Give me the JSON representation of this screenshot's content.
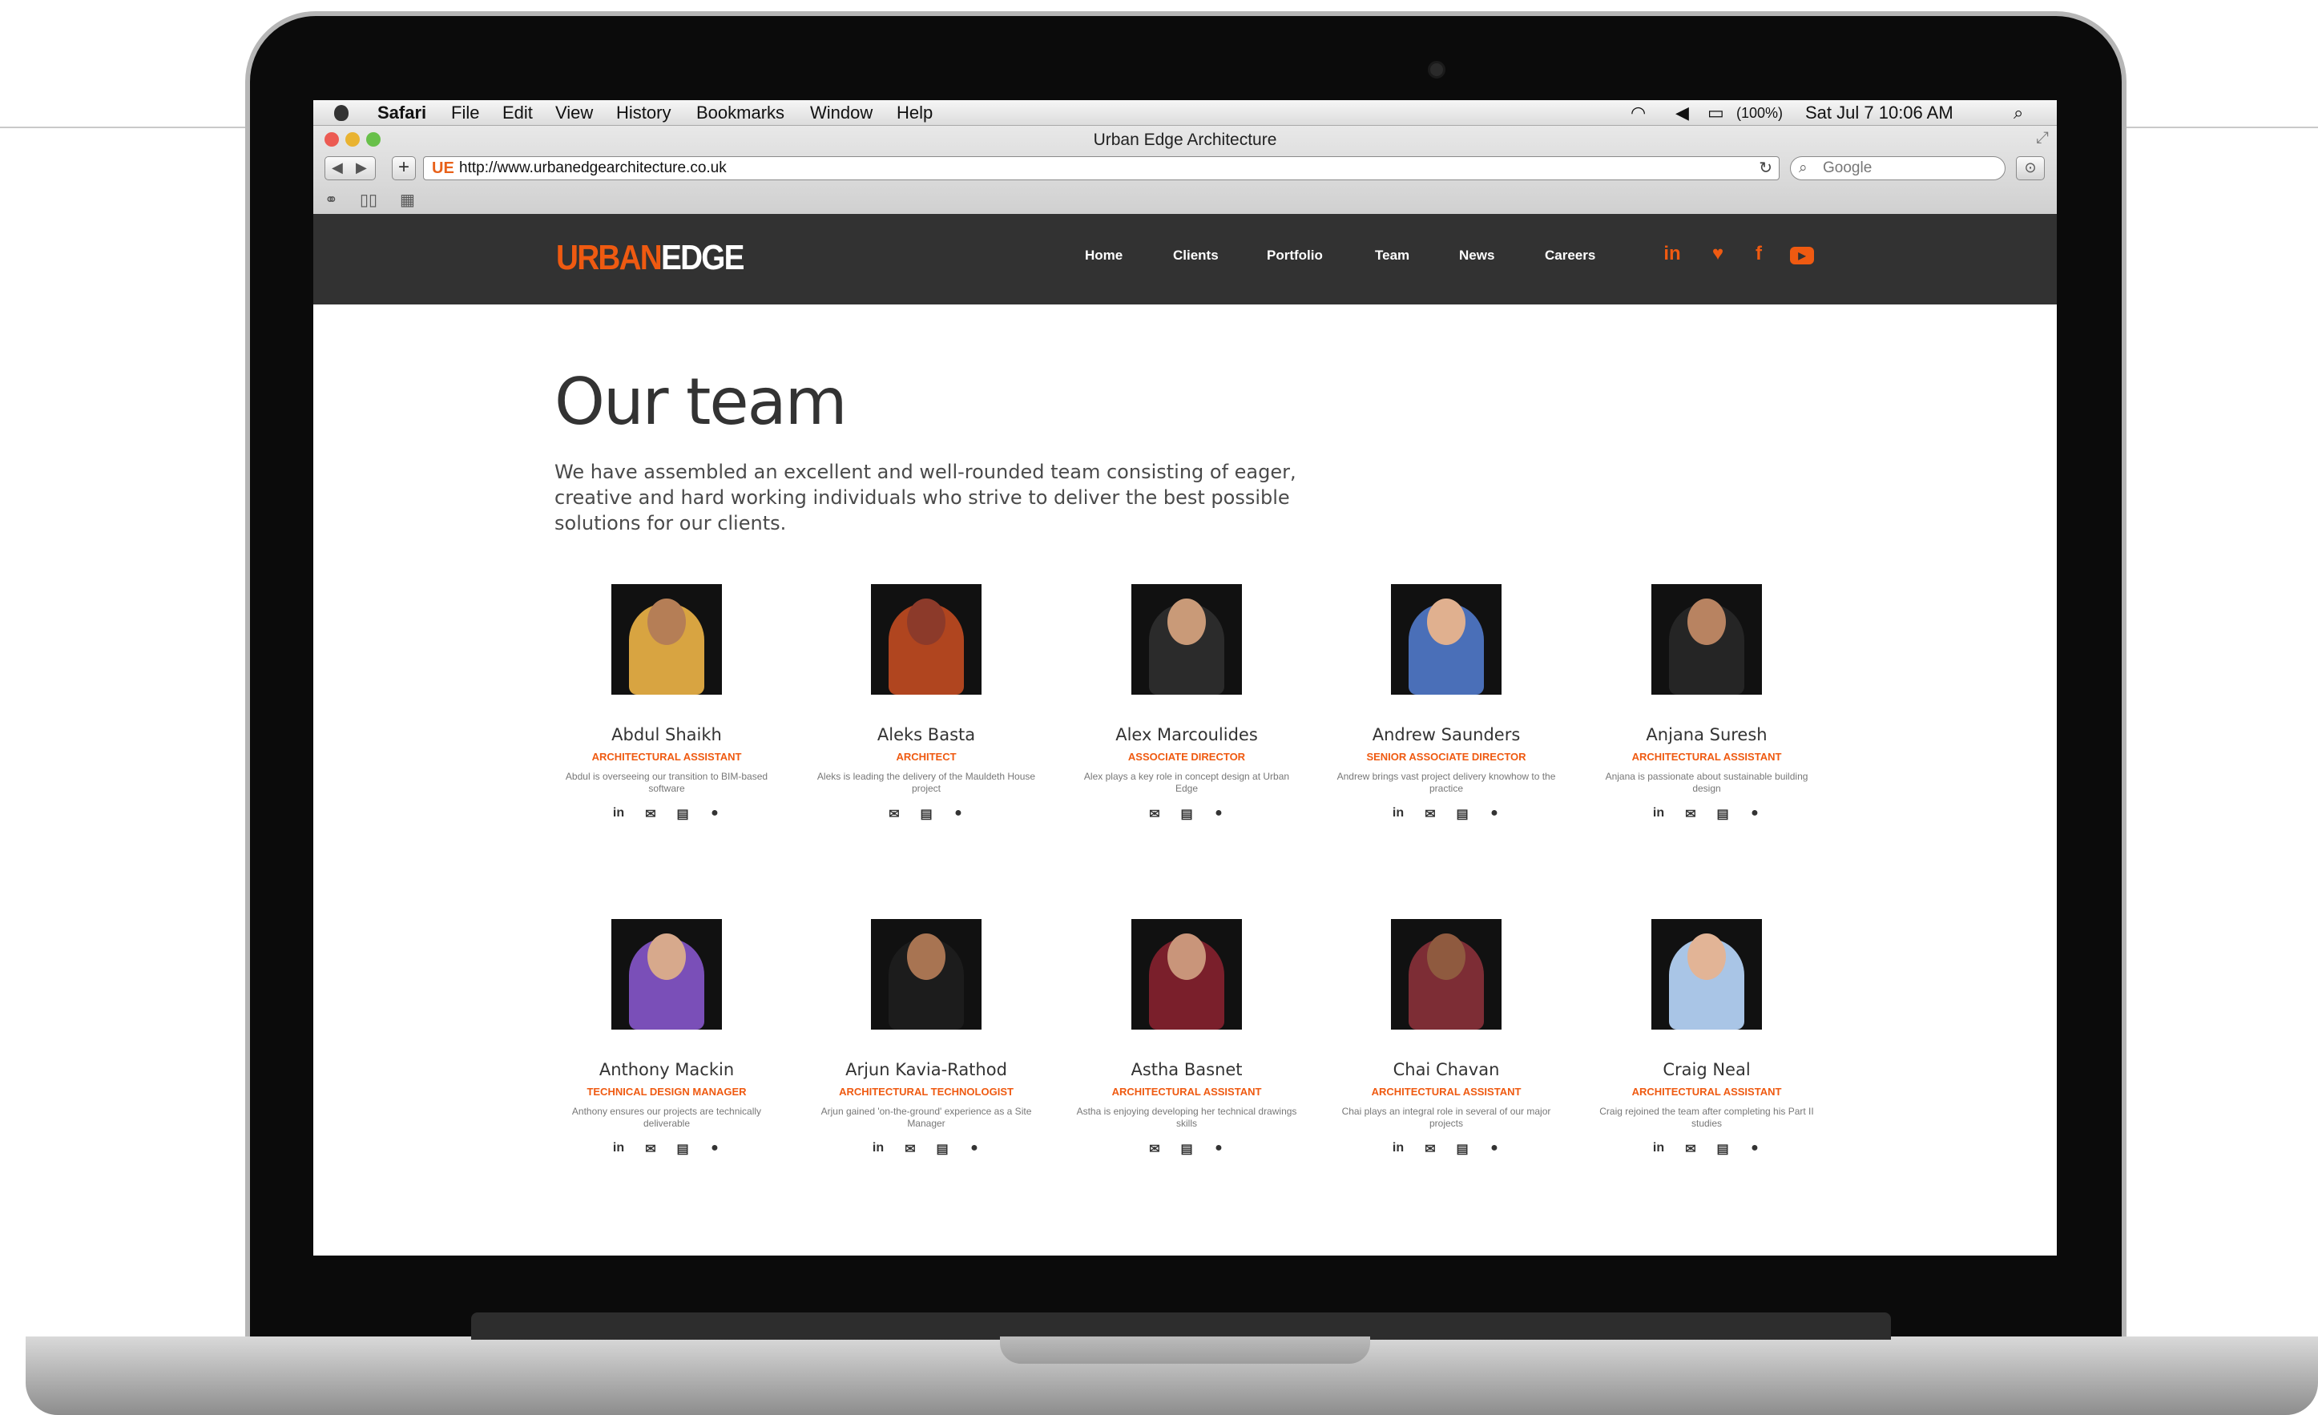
{
  "menubar": {
    "app": "Safari",
    "menus": [
      "File",
      "Edit",
      "View",
      "History",
      "Bookmarks",
      "Window",
      "Help"
    ],
    "battery": "(100%)",
    "datetime": "Sat Jul 7  10:06 AM"
  },
  "browser": {
    "window_title": "Urban Edge Architecture",
    "favicon": "UE",
    "url": "http://www.urbanedgearchitecture.co.uk",
    "search_placeholder": "Google"
  },
  "site": {
    "logo_part1": "URBAN",
    "logo_part2": "EDGE",
    "nav": [
      "Home",
      "Clients",
      "Portfolio",
      "Team",
      "News",
      "Careers"
    ],
    "social": [
      "linkedin-icon",
      "twitter-icon",
      "facebook-icon",
      "youtube-icon"
    ],
    "accent_color": "#ef5a11",
    "header_color": "#323232"
  },
  "page": {
    "title": "Our team",
    "intro": "We have assembled an excellent and well-rounded team consisting of eager, creative and hard working individuals who strive to deliver the best possible solutions for our clients."
  },
  "team": [
    {
      "name": "Abdul Shaikh",
      "role": "ARCHITECTURAL ASSISTANT",
      "desc": "Abdul is overseeing our transition to BIM-based software",
      "icons": [
        "in",
        "✉",
        "▤",
        "●"
      ]
    },
    {
      "name": "Aleks Basta",
      "role": "ARCHITECT",
      "desc": "Aleks is leading the delivery of the Mauldeth House project",
      "icons": [
        "✉",
        "▤",
        "●"
      ]
    },
    {
      "name": "Alex Marcoulides",
      "role": "ASSOCIATE DIRECTOR",
      "desc": "Alex plays a key role in concept design at Urban Edge",
      "icons": [
        "✉",
        "▤",
        "●"
      ]
    },
    {
      "name": "Andrew Saunders",
      "role": "SENIOR ASSOCIATE DIRECTOR",
      "desc": "Andrew brings vast project delivery knowhow to the practice",
      "icons": [
        "in",
        "✉",
        "▤",
        "●"
      ]
    },
    {
      "name": "Anjana Suresh",
      "role": "ARCHITECTURAL ASSISTANT",
      "desc": "Anjana is passionate about sustainable building design",
      "icons": [
        "in",
        "✉",
        "▤",
        "●"
      ]
    },
    {
      "name": "Anthony Mackin",
      "role": "TECHNICAL DESIGN MANAGER",
      "desc": "Anthony ensures our projects are technically deliverable",
      "icons": [
        "in",
        "✉",
        "▤",
        "●"
      ]
    },
    {
      "name": "Arjun Kavia-Rathod",
      "role": "ARCHITECTURAL TECHNOLOGIST",
      "desc": "Arjun gained 'on-the-ground' experience as a Site Manager",
      "icons": [
        "in",
        "✉",
        "▤",
        "●"
      ]
    },
    {
      "name": "Astha Basnet",
      "role": "ARCHITECTURAL ASSISTANT",
      "desc": "Astha is enjoying developing her technical drawings skills",
      "icons": [
        "✉",
        "▤",
        "●"
      ]
    },
    {
      "name": "Chai Chavan",
      "role": "ARCHITECTURAL ASSISTANT",
      "desc": "Chai plays an integral role in several of our major projects",
      "icons": [
        "in",
        "✉",
        "▤",
        "●"
      ]
    },
    {
      "name": "Craig Neal",
      "role": "ARCHITECTURAL ASSISTANT",
      "desc": "Craig rejoined the team after completing his Part II studies",
      "icons": [
        "in",
        "✉",
        "▤",
        "●"
      ]
    }
  ]
}
